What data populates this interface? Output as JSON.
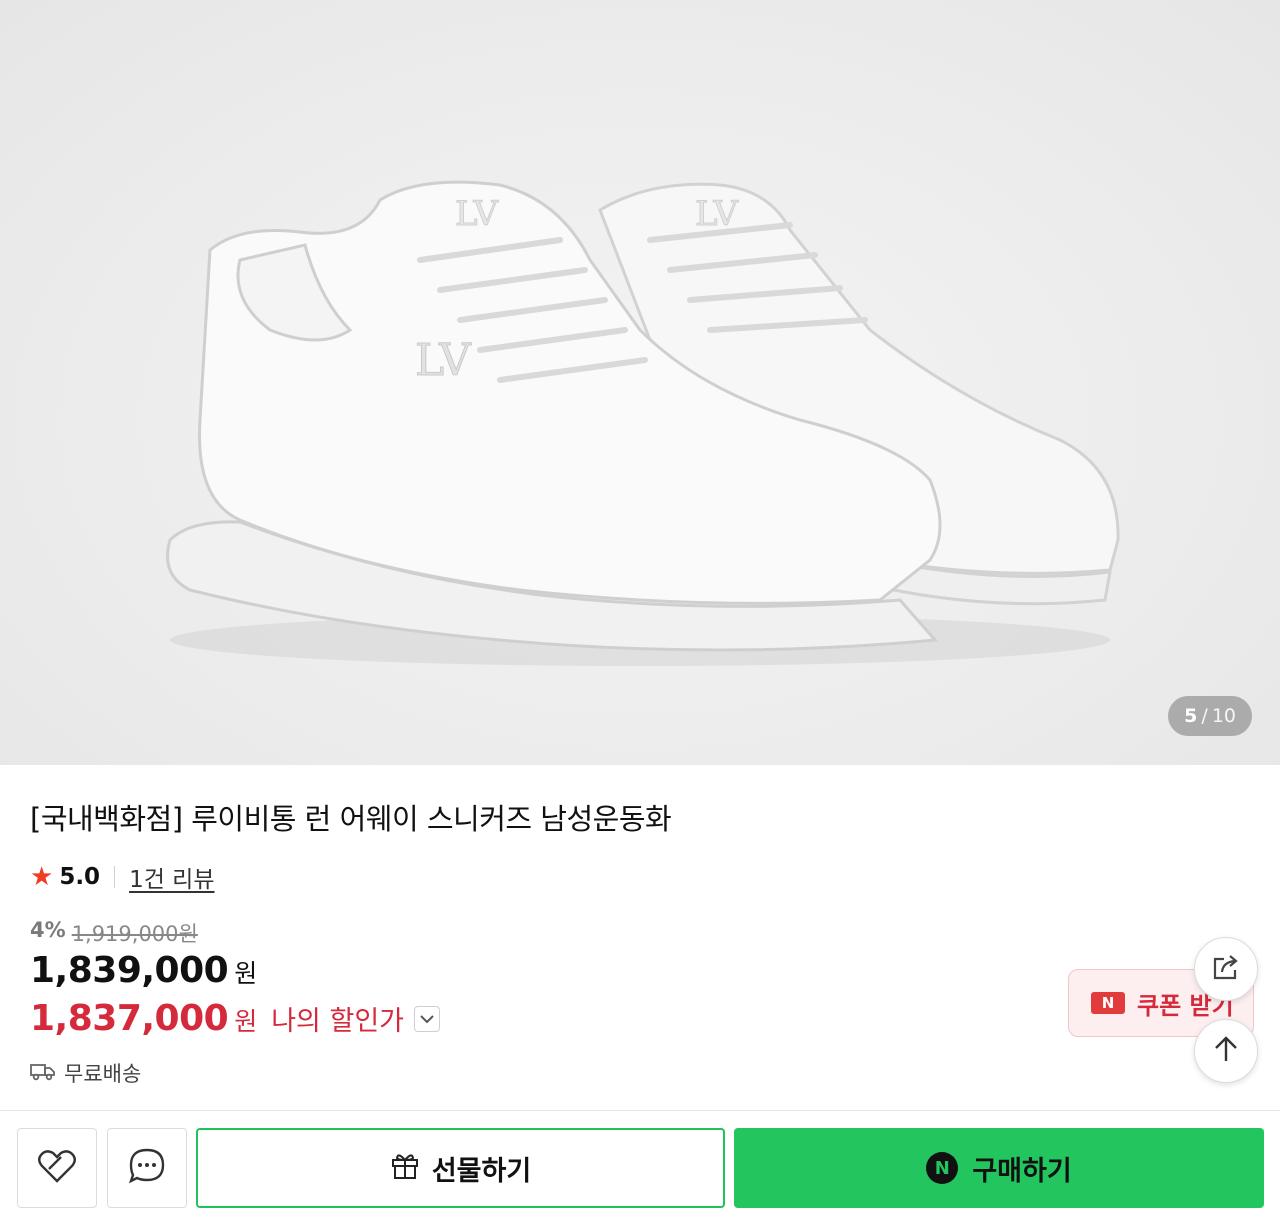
{
  "gallery": {
    "current": "5",
    "separator": "/",
    "total": "10"
  },
  "product": {
    "title": "[국내백화점] 루이비통 런 어웨이 스니커즈 남성운동화",
    "rating": "5.0",
    "reviews_label": "1건 리뷰",
    "discount_pct": "4%",
    "original_price": "1,919,000원",
    "price": "1,839,000",
    "price_unit": "원",
    "my_price": "1,837,000",
    "my_price_unit": "원",
    "my_price_label": "나의 할인가",
    "shipping": "무료배송"
  },
  "coupon": {
    "badge": "N",
    "label": "쿠폰 받기"
  },
  "actions": {
    "gift_label": "선물하기",
    "buy_label": "구매하기",
    "buy_badge": "N"
  },
  "colors": {
    "accent_green": "#22c55e",
    "discount_red": "#d42a3c",
    "star": "#ef3c23"
  },
  "icons": [
    "star-icon",
    "chevron-down-icon",
    "truck-icon",
    "share-icon",
    "arrow-up-icon",
    "heart-icon",
    "chat-icon",
    "gift-icon",
    "naver-pay-icon"
  ]
}
